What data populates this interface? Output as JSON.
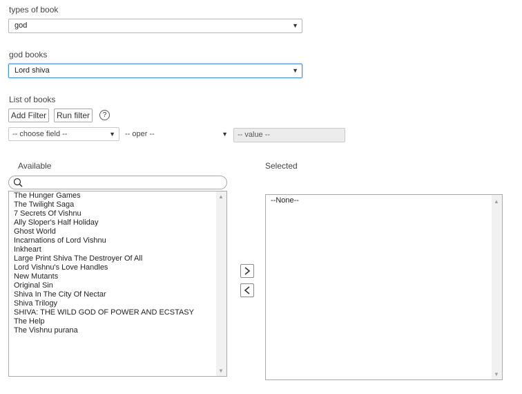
{
  "types_of_book": {
    "label": "types of book",
    "selected": "god"
  },
  "god_books": {
    "label": "god books",
    "selected": "Lord shiva"
  },
  "list_of_books": {
    "label": "List of books",
    "add_filter": "Add Filter",
    "run_filter": "Run filter",
    "help": "?",
    "field_placeholder": "-- choose field --",
    "oper_placeholder": "-- oper --",
    "value_placeholder": "-- value --"
  },
  "available": {
    "label": "Available",
    "items": [
      "The Hunger Games",
      "The Twilight Saga",
      "7 Secrets Of Vishnu",
      "Ally Sloper's Half Holiday",
      "Ghost World",
      "Incarnations of Lord Vishnu",
      "Inkheart",
      "Large Print Shiva The Destroyer Of All",
      "Lord Vishnu's Love Handles",
      "New Mutants",
      "Original Sin",
      "Shiva In The City Of Nectar",
      "Shiva Trilogy",
      "SHIVA: THE WILD GOD OF POWER AND ECSTASY",
      "The Help",
      "The Vishnu purana"
    ]
  },
  "selected": {
    "label": "Selected",
    "items": [
      "--None--"
    ]
  },
  "icons": {
    "search": "search-icon",
    "move_right": "chevron-right-icon",
    "move_left": "chevron-left-icon",
    "dropdown": "triangle-down-icon"
  },
  "colors": {
    "focus_border": "#4a90d9",
    "disabled_bg": "#ececec"
  }
}
